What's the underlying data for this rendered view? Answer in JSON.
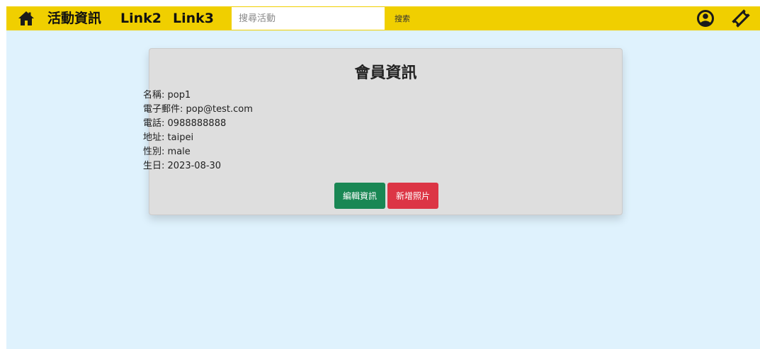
{
  "navbar": {
    "home_icon": "home-icon",
    "links": [
      "活動資訊",
      "Link2",
      "Link3"
    ],
    "search": {
      "placeholder": "搜尋活動",
      "value": "",
      "button_label": "搜索"
    },
    "user_icon": "user-circle-icon",
    "ticket_icon": "ticket-icon",
    "accent_color": "#f0cf00"
  },
  "profile": {
    "title": "會員資訊",
    "fields": [
      {
        "label": "名稱",
        "value": "pop1"
      },
      {
        "label": "電子郵件",
        "value": "pop@test.com"
      },
      {
        "label": "電話",
        "value": "0988888888"
      },
      {
        "label": "地址",
        "value": "taipei"
      },
      {
        "label": "性別",
        "value": "male"
      },
      {
        "label": "生日",
        "value": "2023-08-30"
      }
    ],
    "buttons": {
      "edit_label": "編輯資訊",
      "add_photo_label": "新增照片"
    }
  },
  "colors": {
    "background": "#dff2fd",
    "card": "#dedede",
    "edit_button": "#198754",
    "photo_button": "#dc3545"
  }
}
